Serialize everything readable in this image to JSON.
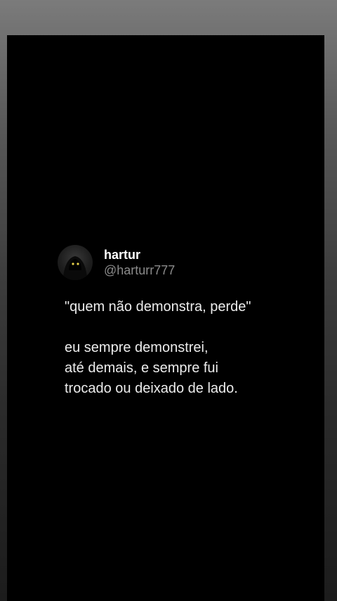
{
  "tweet": {
    "display_name": "hartur",
    "handle": "@harturr777",
    "avatar_icon": "hooded-figure-avatar",
    "quote": "\"quem não demonstra, perde\"",
    "lines": [
      "eu sempre demonstrei,",
      "até demais, e sempre fui",
      "trocado ou deixado de lado."
    ]
  },
  "colors": {
    "card_background": "#000000",
    "text_primary": "#ffffff",
    "text_secondary": "#8b8b8b",
    "avatar_eyes": "#e8d24a"
  }
}
